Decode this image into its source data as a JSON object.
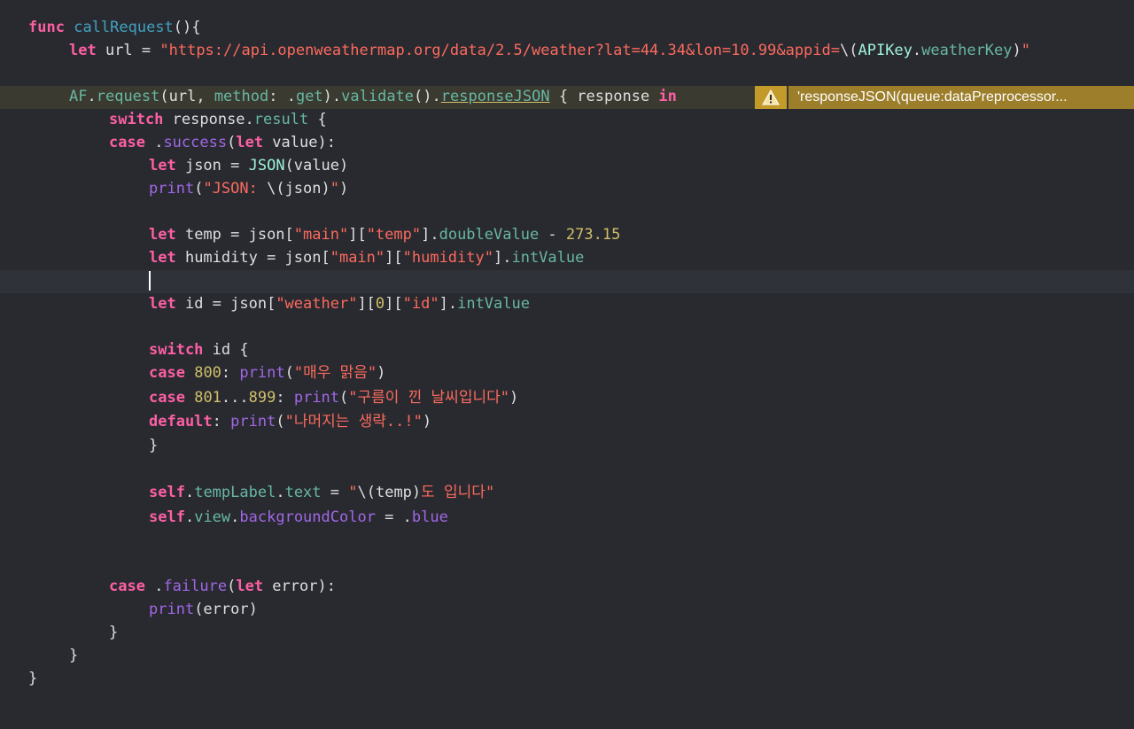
{
  "colors": {
    "background": "#292a30",
    "keyword": "#fc5fa3",
    "string": "#fc6a5d",
    "number": "#d0bf69",
    "function_call": "#67b7a4",
    "declaration": "#41a1c0",
    "warning_bg": "#9c7e2b"
  },
  "warning": {
    "icon": "warning-triangle-icon",
    "message": "'responseJSON(queue:dataPreprocessor..."
  },
  "lines": [
    [
      {
        "t": "func",
        "c": "kw"
      },
      {
        "t": " "
      },
      {
        "t": "callRequest",
        "c": "decl"
      },
      {
        "t": "(){"
      }
    ],
    [
      {
        "t": "let",
        "c": "kw"
      },
      {
        "t": " url = "
      },
      {
        "t": "\"https://api.openweathermap.org/data/2.5/weather?lat=44.34&lon=10.99&appid=",
        "c": "str"
      },
      {
        "t": "\\("
      },
      {
        "t": "APIKey",
        "c": "cls"
      },
      {
        "t": "."
      },
      {
        "t": "weatherKey",
        "c": "fn"
      },
      {
        "t": ")"
      },
      {
        "t": "\"",
        "c": "str"
      }
    ],
    [],
    [
      {
        "t": "AF",
        "c": "fn"
      },
      {
        "t": "."
      },
      {
        "t": "request",
        "c": "fn"
      },
      {
        "t": "(url, "
      },
      {
        "t": "method",
        "c": "fn"
      },
      {
        "t": ": ."
      },
      {
        "t": "get",
        "c": "fn"
      },
      {
        "t": ")."
      },
      {
        "t": "validate",
        "c": "fn"
      },
      {
        "t": "()."
      },
      {
        "t": "responseJSON",
        "c": "fn",
        "u": true
      },
      {
        "t": " { response "
      },
      {
        "t": "in",
        "c": "kw"
      }
    ],
    [
      {
        "t": "switch",
        "c": "kw"
      },
      {
        "t": " response."
      },
      {
        "t": "result",
        "c": "fn"
      },
      {
        "t": " {"
      }
    ],
    [
      {
        "t": "case",
        "c": "kw"
      },
      {
        "t": " ."
      },
      {
        "t": "success",
        "c": "lib"
      },
      {
        "t": "("
      },
      {
        "t": "let",
        "c": "kw"
      },
      {
        "t": " value):"
      }
    ],
    [
      {
        "t": "let",
        "c": "kw"
      },
      {
        "t": " json = "
      },
      {
        "t": "JSON",
        "c": "cls"
      },
      {
        "t": "(value)"
      }
    ],
    [
      {
        "t": "print",
        "c": "lib"
      },
      {
        "t": "("
      },
      {
        "t": "\"JSON: ",
        "c": "str"
      },
      {
        "t": "\\(json)"
      },
      {
        "t": "\"",
        "c": "str"
      },
      {
        "t": ")"
      }
    ],
    [],
    [
      {
        "t": "let",
        "c": "kw"
      },
      {
        "t": " temp = json["
      },
      {
        "t": "\"main\"",
        "c": "str"
      },
      {
        "t": "]["
      },
      {
        "t": "\"temp\"",
        "c": "str"
      },
      {
        "t": "]."
      },
      {
        "t": "doubleValue",
        "c": "fn"
      },
      {
        "t": " - "
      },
      {
        "t": "273.15",
        "c": "num"
      }
    ],
    [
      {
        "t": "let",
        "c": "kw"
      },
      {
        "t": " humidity = json["
      },
      {
        "t": "\"main\"",
        "c": "str"
      },
      {
        "t": "]["
      },
      {
        "t": "\"humidity\"",
        "c": "str"
      },
      {
        "t": "]."
      },
      {
        "t": "intValue",
        "c": "fn"
      }
    ],
    [],
    [
      {
        "t": "let",
        "c": "kw"
      },
      {
        "t": " id = json["
      },
      {
        "t": "\"weather\"",
        "c": "str"
      },
      {
        "t": "]["
      },
      {
        "t": "0",
        "c": "num"
      },
      {
        "t": "]["
      },
      {
        "t": "\"id\"",
        "c": "str"
      },
      {
        "t": "]."
      },
      {
        "t": "intValue",
        "c": "fn"
      }
    ],
    [],
    [
      {
        "t": "switch",
        "c": "kw"
      },
      {
        "t": " id {"
      }
    ],
    [
      {
        "t": "case",
        "c": "kw"
      },
      {
        "t": " "
      },
      {
        "t": "800",
        "c": "num"
      },
      {
        "t": ": "
      },
      {
        "t": "print",
        "c": "lib"
      },
      {
        "t": "("
      },
      {
        "t": "\"매우 맑음\"",
        "c": "str"
      },
      {
        "t": ")"
      }
    ],
    [
      {
        "t": "case",
        "c": "kw"
      },
      {
        "t": " "
      },
      {
        "t": "801",
        "c": "num"
      },
      {
        "t": "..."
      },
      {
        "t": "899",
        "c": "num"
      },
      {
        "t": ": "
      },
      {
        "t": "print",
        "c": "lib"
      },
      {
        "t": "("
      },
      {
        "t": "\"구름이 낀 날씨입니다\"",
        "c": "str"
      },
      {
        "t": ")"
      }
    ],
    [
      {
        "t": "default",
        "c": "kw"
      },
      {
        "t": ": "
      },
      {
        "t": "print",
        "c": "lib"
      },
      {
        "t": "("
      },
      {
        "t": "\"나머지는 생략..!\"",
        "c": "str"
      },
      {
        "t": ")"
      }
    ],
    [
      {
        "t": "}"
      }
    ],
    [],
    [
      {
        "t": "self",
        "c": "kw"
      },
      {
        "t": "."
      },
      {
        "t": "tempLabel",
        "c": "fn"
      },
      {
        "t": "."
      },
      {
        "t": "text",
        "c": "fn"
      },
      {
        "t": " = "
      },
      {
        "t": "\"",
        "c": "str"
      },
      {
        "t": "\\(temp)"
      },
      {
        "t": "도 입니다\"",
        "c": "str"
      }
    ],
    [
      {
        "t": "self",
        "c": "kw"
      },
      {
        "t": "."
      },
      {
        "t": "view",
        "c": "fn"
      },
      {
        "t": "."
      },
      {
        "t": "backgroundColor",
        "c": "lib"
      },
      {
        "t": " = ."
      },
      {
        "t": "blue",
        "c": "lib"
      }
    ],
    [],
    [],
    [
      {
        "t": "case",
        "c": "kw"
      },
      {
        "t": " ."
      },
      {
        "t": "failure",
        "c": "lib"
      },
      {
        "t": "("
      },
      {
        "t": "let",
        "c": "kw"
      },
      {
        "t": " error):"
      }
    ],
    [
      {
        "t": "print",
        "c": "lib"
      },
      {
        "t": "(error)"
      }
    ],
    [
      {
        "t": "}"
      }
    ],
    [
      {
        "t": "}"
      }
    ],
    [
      {
        "t": "}"
      }
    ]
  ]
}
